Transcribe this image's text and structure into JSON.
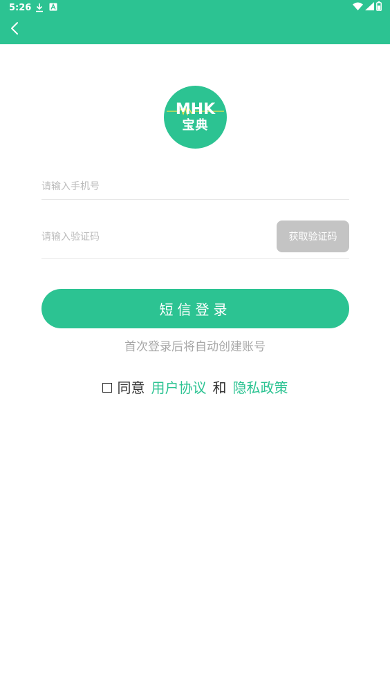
{
  "status_bar": {
    "time": "5:26",
    "icons_left": [
      "download-icon",
      "a-icon"
    ],
    "icons_right": [
      "wifi-icon",
      "signal-icon",
      "battery-icon"
    ]
  },
  "header": {
    "back_icon": "chevron-left-icon",
    "color": "#2cc392"
  },
  "logo": {
    "line1": "MHK",
    "line2": "宝典"
  },
  "form": {
    "phone_placeholder": "请输入手机号",
    "code_placeholder": "请输入验证码",
    "get_code_label": "获取验证码",
    "login_label": "短信登录",
    "hint": "首次登录后将自动创建账号"
  },
  "agreement": {
    "agree_label": "同意",
    "user_agreement": "用户协议",
    "and": "和",
    "privacy_policy": "隐私政策"
  },
  "colors": {
    "accent": "#2cc392",
    "disabled_button": "#c4c4c4",
    "hint_text": "#a8a8a8"
  }
}
